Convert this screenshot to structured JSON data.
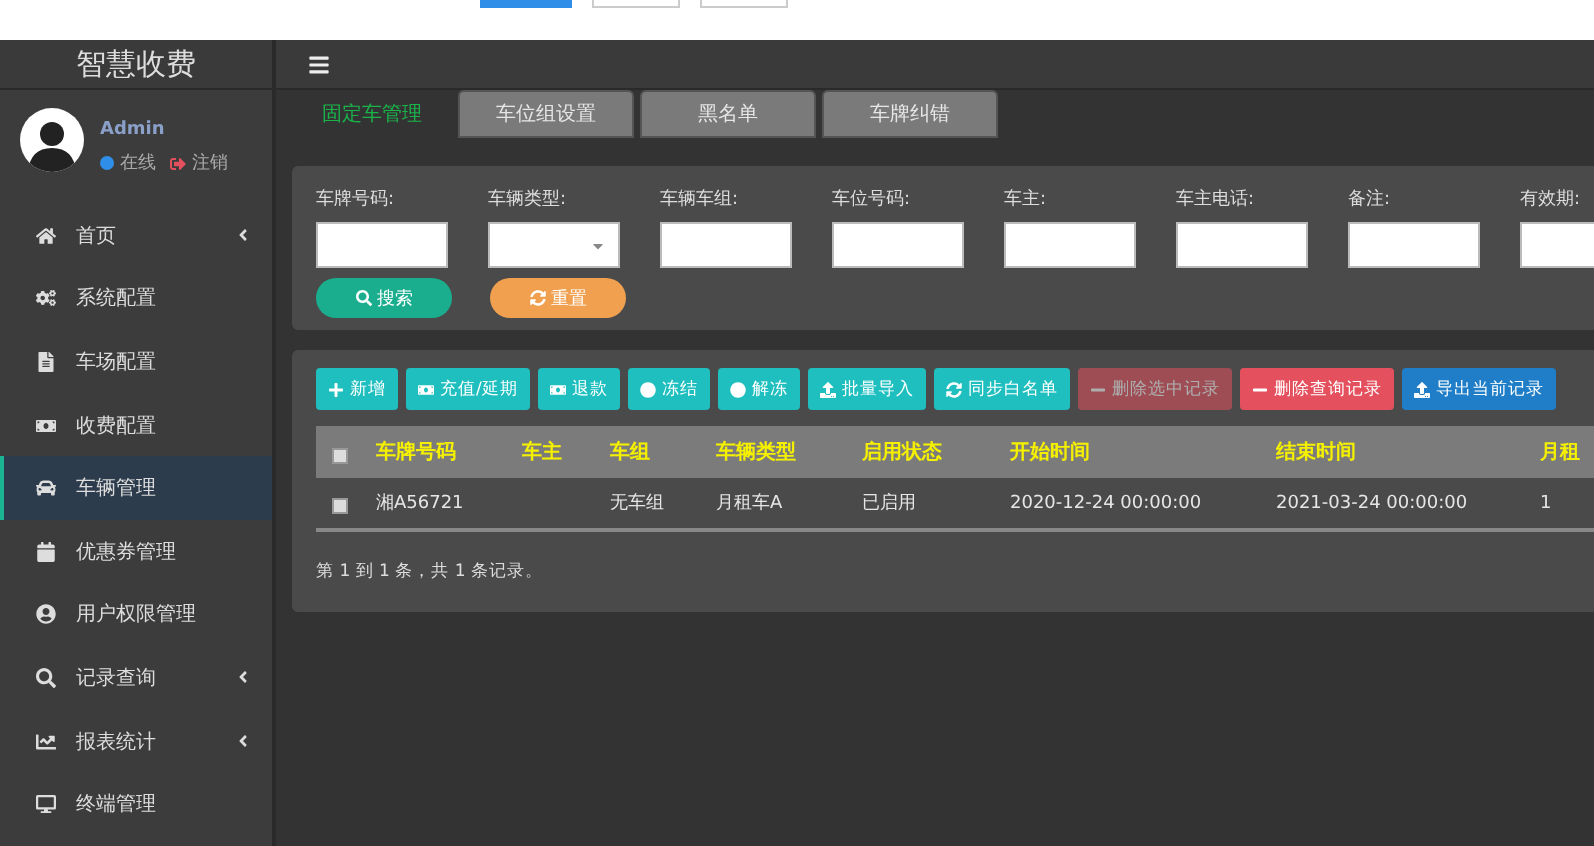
{
  "header": {
    "logo": "智慧收费"
  },
  "user": {
    "name": "Admin",
    "status": "在线",
    "logout": "注销"
  },
  "menu": [
    {
      "label": "首页",
      "expandable": true,
      "selected": false
    },
    {
      "label": "系统配置",
      "expandable": false,
      "selected": false
    },
    {
      "label": "车场配置",
      "expandable": false,
      "selected": false
    },
    {
      "label": "收费配置",
      "expandable": false,
      "selected": false
    },
    {
      "label": "车辆管理",
      "expandable": false,
      "selected": true
    },
    {
      "label": "优惠券管理",
      "expandable": false,
      "selected": false
    },
    {
      "label": "用户权限管理",
      "expandable": false,
      "selected": false
    },
    {
      "label": "记录查询",
      "expandable": true,
      "selected": false
    },
    {
      "label": "报表统计",
      "expandable": true,
      "selected": false
    },
    {
      "label": "终端管理",
      "expandable": false,
      "selected": false
    }
  ],
  "tabs": [
    {
      "label": "固定车管理",
      "selected": true
    },
    {
      "label": "车位组设置",
      "selected": false
    },
    {
      "label": "黑名单",
      "selected": false
    },
    {
      "label": "车牌纠错",
      "selected": false
    }
  ],
  "filters": [
    {
      "label": "车牌号码:",
      "kind": "text"
    },
    {
      "label": "车辆类型:",
      "kind": "select"
    },
    {
      "label": "车辆车组:",
      "kind": "text"
    },
    {
      "label": "车位号码:",
      "kind": "text"
    },
    {
      "label": "车主:",
      "kind": "text"
    },
    {
      "label": "车主电话:",
      "kind": "text"
    },
    {
      "label": "备注:",
      "kind": "text"
    },
    {
      "label": "有效期:",
      "kind": "text"
    }
  ],
  "search_buttons": [
    {
      "label": "搜索",
      "kind": "search"
    },
    {
      "label": "重置",
      "kind": "reset"
    }
  ],
  "actions": [
    {
      "label": "新增",
      "kind": "primary",
      "disabled": false
    },
    {
      "label": "充值/延期",
      "kind": "primary",
      "disabled": false
    },
    {
      "label": "退款",
      "kind": "primary",
      "disabled": false
    },
    {
      "label": "冻结",
      "kind": "primary",
      "disabled": false
    },
    {
      "label": "解冻",
      "kind": "primary",
      "disabled": false
    },
    {
      "label": "批量导入",
      "kind": "primary",
      "disabled": false
    },
    {
      "label": "同步白名单",
      "kind": "primary",
      "disabled": false
    },
    {
      "label": "删除选中记录",
      "kind": "danger",
      "disabled": true
    },
    {
      "label": "删除查询记录",
      "kind": "danger",
      "disabled": false
    },
    {
      "label": "导出当前记录",
      "kind": "export",
      "disabled": false
    }
  ],
  "table": {
    "columns": [
      "车牌号码",
      "车主",
      "车组",
      "车辆类型",
      "启用状态",
      "开始时间",
      "结束时间",
      "月租"
    ],
    "all_checked": false,
    "rows": [
      {
        "checked": false,
        "cells": [
          "湘A56721",
          "",
          "无车组",
          "月租车A",
          "已启用",
          "2020-12-24 00:00:00",
          "2021-03-24 00:00:00",
          "1"
        ]
      }
    ]
  },
  "pagination": "第 1 到 1 条，共 1 条记录。"
}
